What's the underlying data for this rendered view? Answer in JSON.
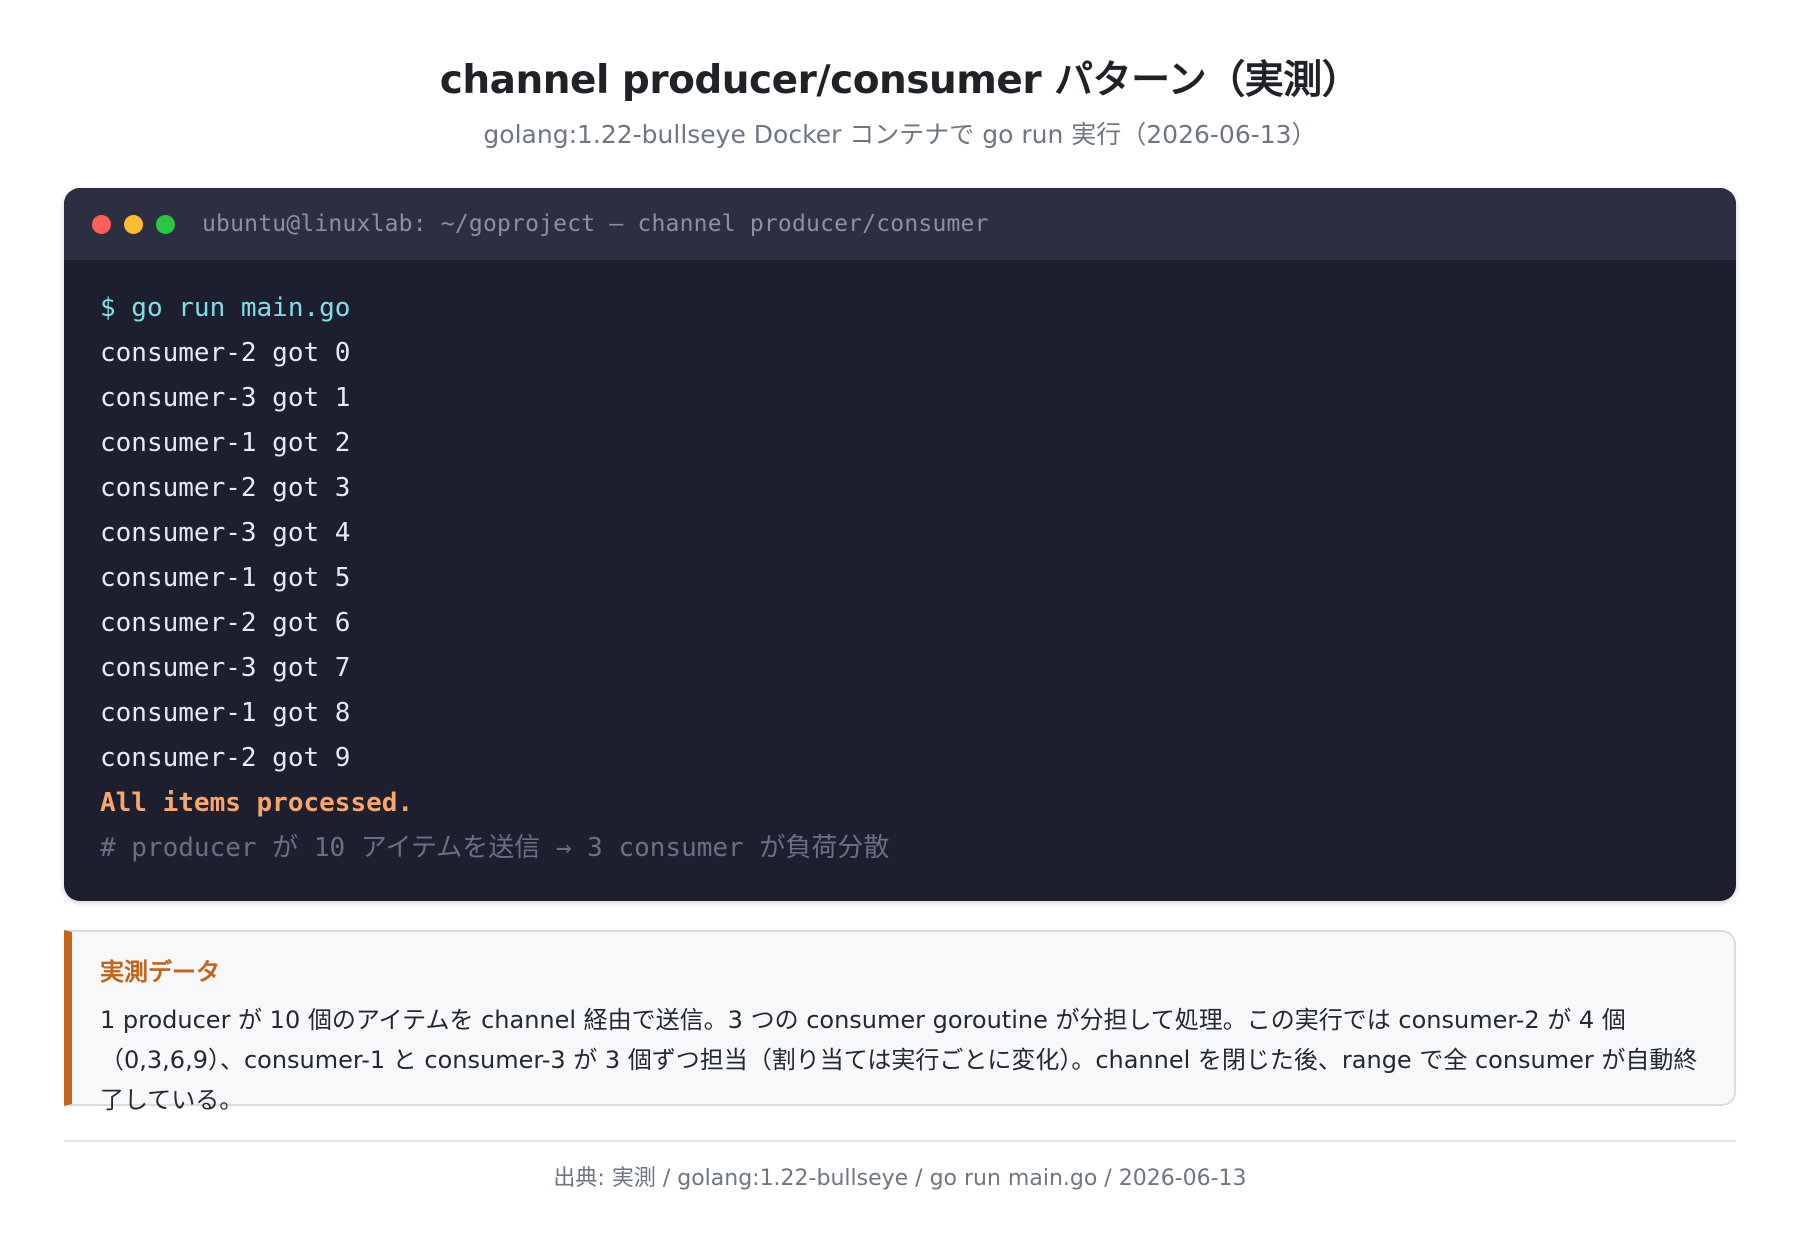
{
  "page": {
    "title": "channel producer/consumer パターン（実測）",
    "subtitle": "golang:1.22-bullseye Docker コンテナで go run 実行（2026-06-13）"
  },
  "terminal": {
    "title": "ubuntu@linuxlab: ~/goproject — channel producer/consumer",
    "command": "$ go run main.go",
    "output_lines": [
      "consumer-2 got 0",
      "consumer-3 got 1",
      "consumer-1 got 2",
      "consumer-2 got 3",
      "consumer-3 got 4",
      "consumer-1 got 5",
      "consumer-2 got 6",
      "consumer-3 got 7",
      "consumer-1 got 8",
      "consumer-2 got 9"
    ],
    "done_line": "All items processed.",
    "comment_line": "# producer が 10 アイテムを送信 → 3 consumer が負荷分散",
    "colors": {
      "background": "#1e1f2e",
      "titlebar": "#2c2e42",
      "command": "#7fdfe8",
      "done": "#f7a66d",
      "comment": "#6b6f86"
    }
  },
  "note": {
    "heading": "実測データ",
    "text": "1 producer が 10 個のアイテムを channel 経由で送信。3 つの consumer goroutine が分担して処理。この実行では consumer-2 が 4 個（0,3,6,9）、consumer-1 と consumer-3 が 3 個ずつ担当（割り当ては実行ごとに変化）。channel を閉じた後、range で全 consumer が自動終了している。",
    "accent_color": "#c4631a"
  },
  "footer": {
    "source": "出典: 実測 / golang:1.22-bullseye / go run main.go / 2026-06-13"
  }
}
